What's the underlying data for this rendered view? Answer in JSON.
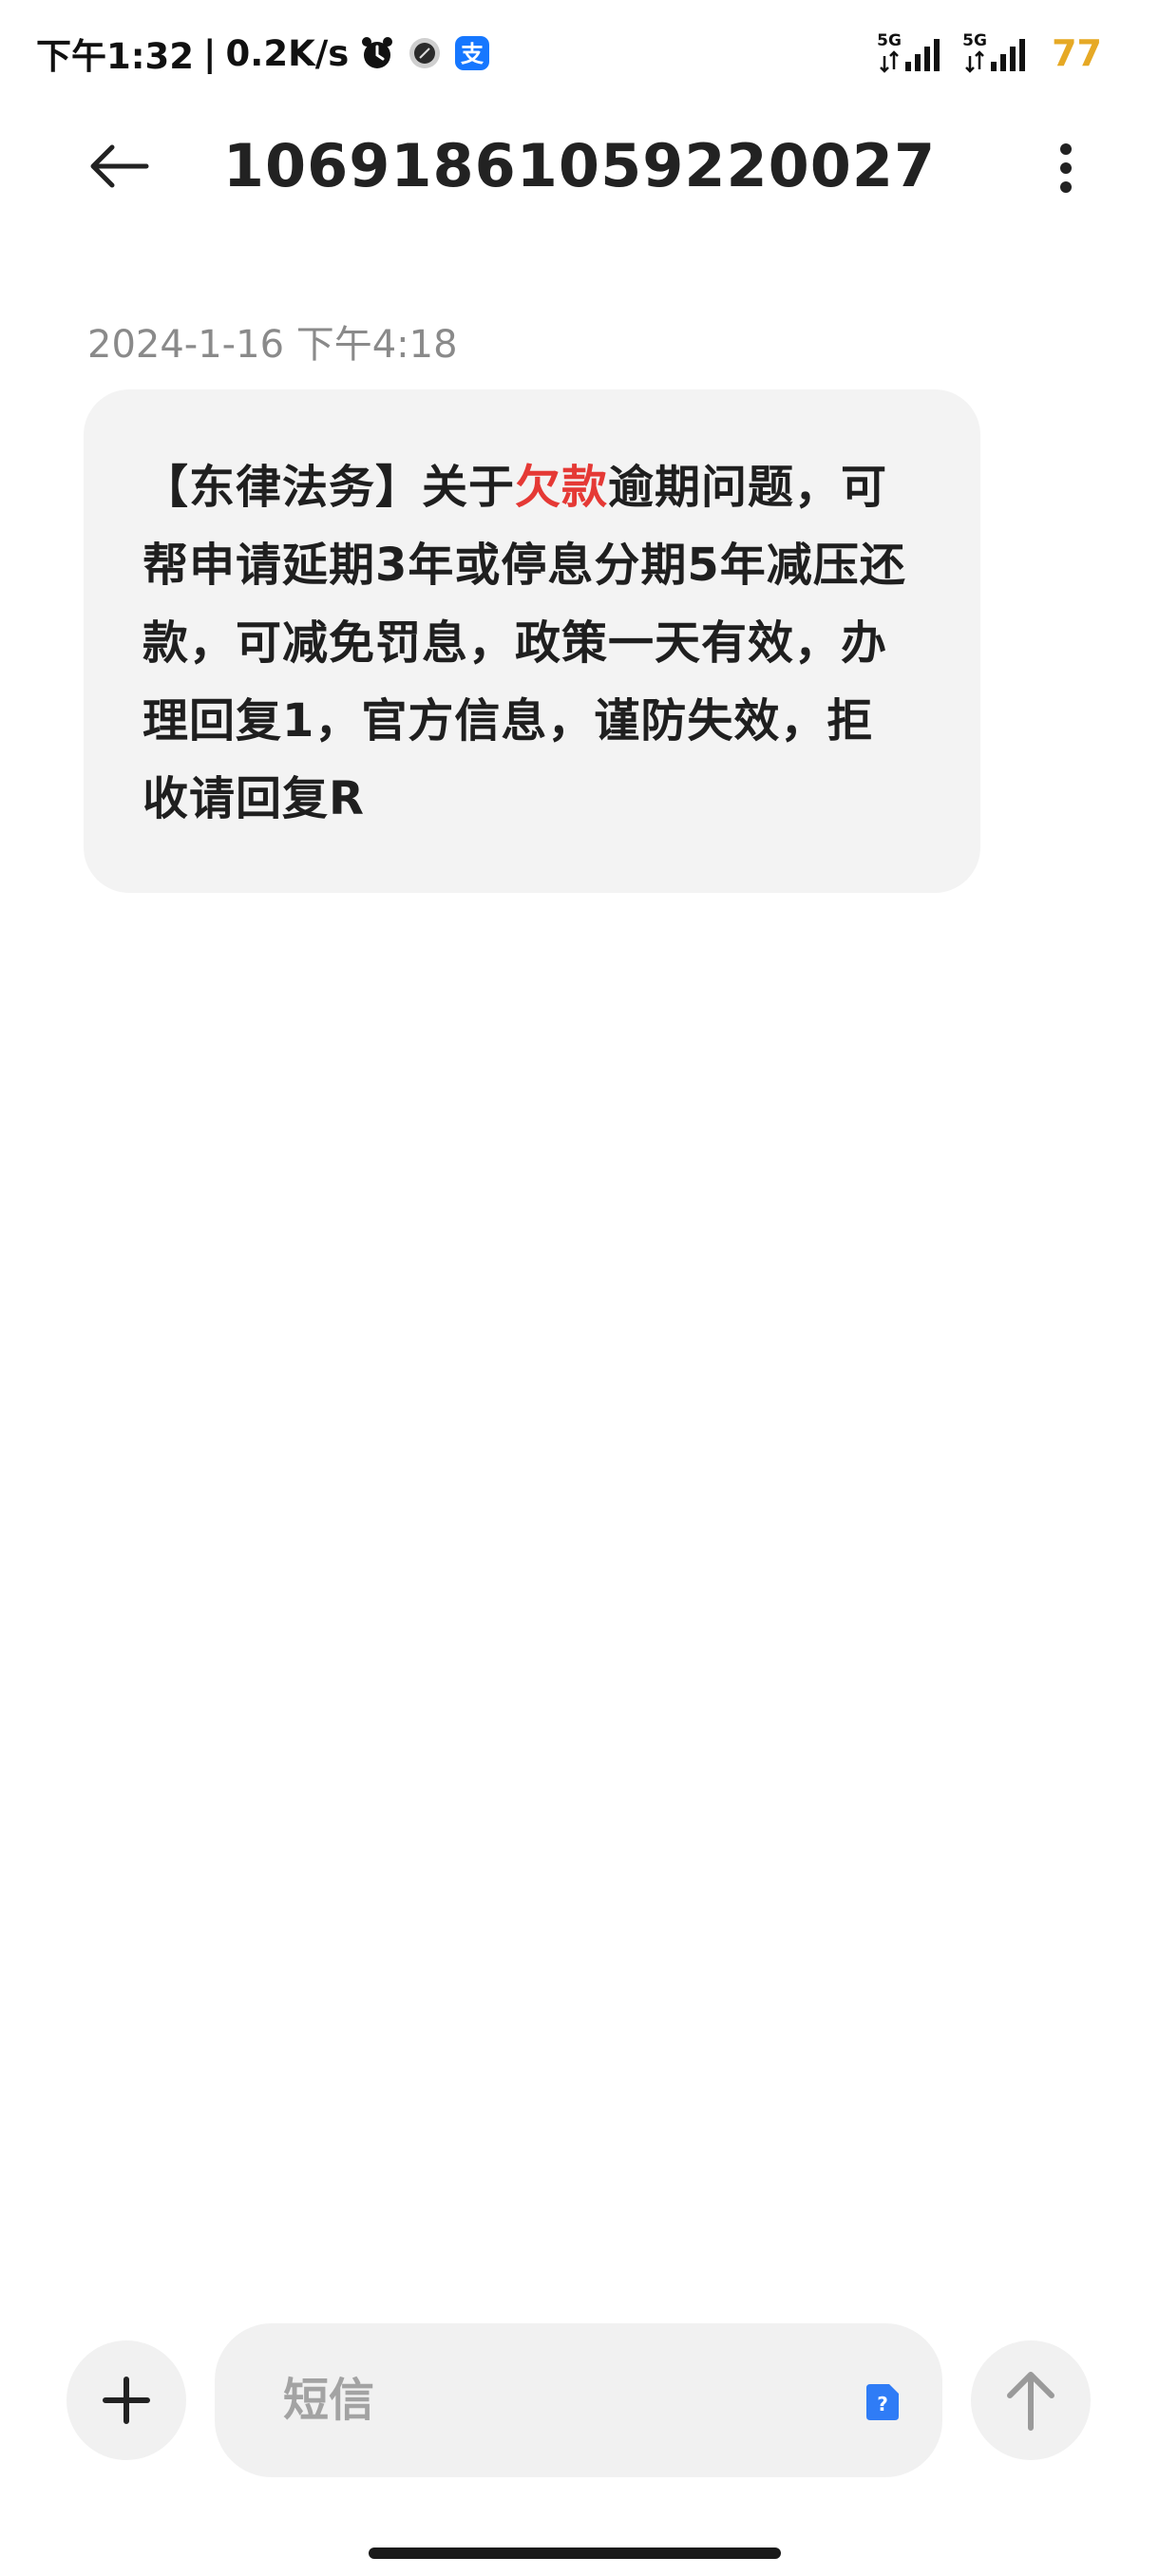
{
  "status_bar": {
    "time": "下午1:32",
    "separator": "|",
    "net_speed": "0.2K/s",
    "sim1_network": "5G",
    "sim2_network": "5G",
    "battery_level": "77",
    "icons": [
      "alarm-icon",
      "app-status-icon",
      "alipay-icon"
    ],
    "battery_color": "#e6a925"
  },
  "header": {
    "title": "10691861059220027",
    "back_icon": "arrow-left-icon",
    "more_icon": "more-vertical-icon"
  },
  "conversation": {
    "timestamp": "2024-1-16 下午4:18",
    "message": {
      "before": "【东律法务】关于",
      "highlight": "欠款",
      "after": "逾期问题，可帮申请延期3年或停息分期5年减压还款，可减免罚息，政策一天有效，办理回复1，官方信息，谨防失效，拒收请回复R"
    },
    "bubble_color": "#f3f3f3",
    "highlight_color": "#e53935"
  },
  "compose": {
    "placeholder": "短信",
    "attach_icon": "plus-icon",
    "sim_icon": "sim-card-icon",
    "send_icon": "arrow-up-icon",
    "accent_color": "#2f7cf6"
  }
}
